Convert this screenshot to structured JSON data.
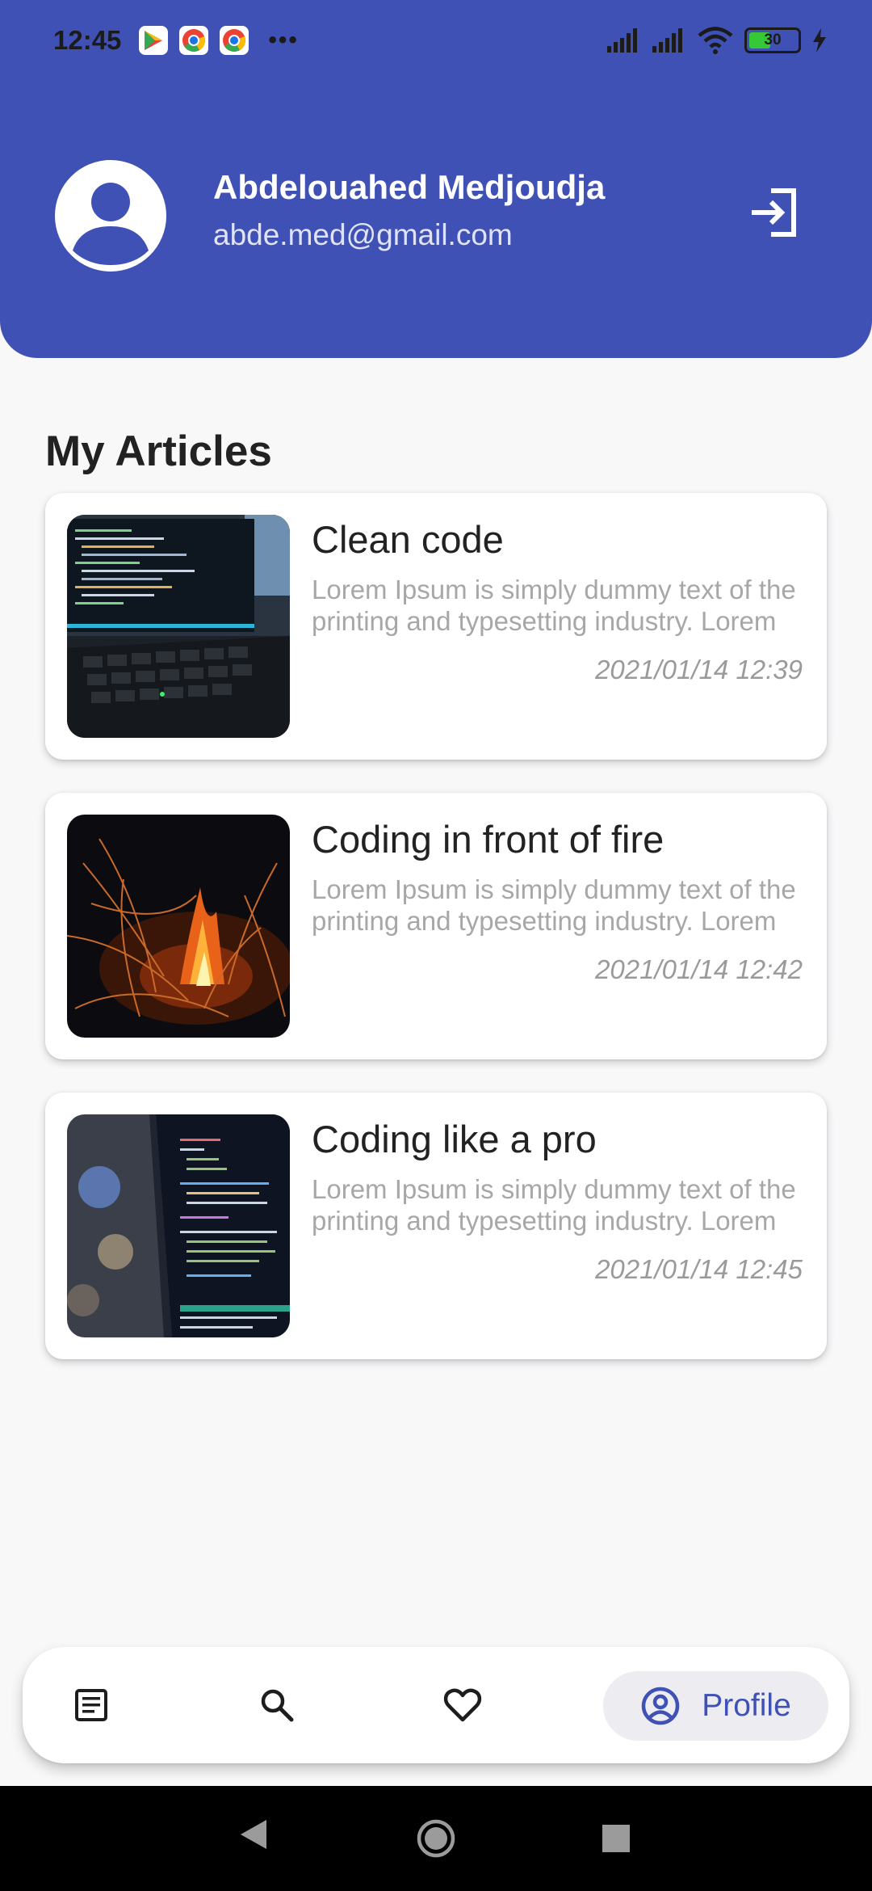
{
  "status_bar": {
    "time": "12:45",
    "battery": "30"
  },
  "profile": {
    "name": "Abdelouahed Medjoudja",
    "email": "abde.med@gmail.com"
  },
  "section_title": "My Articles",
  "articles": [
    {
      "title": "Clean code",
      "description": "Lorem Ipsum is simply dummy text of the printing and typesetting industry. Lorem …",
      "date": "2021/01/14 12:39",
      "image": "laptop-code-image"
    },
    {
      "title": "Coding in front of fire",
      "description": "Lorem Ipsum is simply dummy text of the printing and typesetting industry. Lorem …",
      "date": "2021/01/14 12:42",
      "image": "campfire-image"
    },
    {
      "title": "Coding like a pro",
      "description": "Lorem Ipsum is simply dummy text of the printing and typesetting industry. Lorem …",
      "date": "2021/01/14 12:45",
      "image": "code-screen-image"
    }
  ],
  "bottom_nav": {
    "items": [
      {
        "icon": "article-icon"
      },
      {
        "icon": "search-icon"
      },
      {
        "icon": "heart-icon"
      },
      {
        "icon": "account-circle-icon",
        "label": "Profile",
        "active": true
      }
    ]
  },
  "colors": {
    "primary": "#3f51b5",
    "background": "#f8f8f9",
    "active_tab": "#ececf1"
  }
}
